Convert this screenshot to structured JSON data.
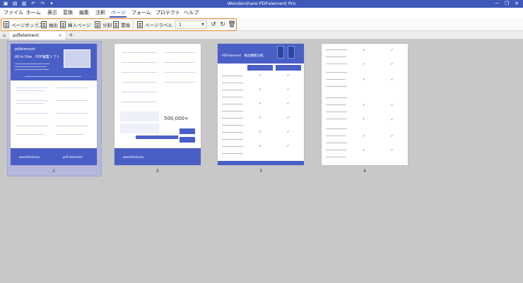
{
  "window": {
    "title": "Wondershare PDFelement Pro",
    "controls": [
      "─",
      "❐",
      "✕"
    ]
  },
  "menu": {
    "items": [
      "ファイル",
      "ホーム",
      "表示",
      "変換",
      "編集",
      "注釈",
      "ページ",
      "フォーム",
      "プロテクト",
      "ヘルプ"
    ],
    "active": "ページ"
  },
  "toolbar": {
    "page_box": "ページボックス",
    "extract": "抽出",
    "insert": "挿入ページ",
    "split": "分割",
    "replace": "置換",
    "page_label": "ページラベル",
    "page_select": "1"
  },
  "tabs": {
    "doc": "pdfelement",
    "close": "×",
    "add": "+"
  },
  "pages": {
    "numbers": [
      "1",
      "2",
      "3",
      "4"
    ]
  },
  "thumb1": {
    "brand": "pdfelement",
    "headline": "All in One　PDF編集ソフト",
    "footer_brand": "wondershare",
    "footer_product": "pdf element"
  },
  "thumb2": {
    "count": "500,000+",
    "footer_brand": "wondershare"
  },
  "thumb3": {
    "title": "PDFelement　製品機能比較"
  },
  "colors": {
    "accent": "#3d58b9",
    "highlight": "#f08a2a",
    "selection": "#b5b8da"
  }
}
